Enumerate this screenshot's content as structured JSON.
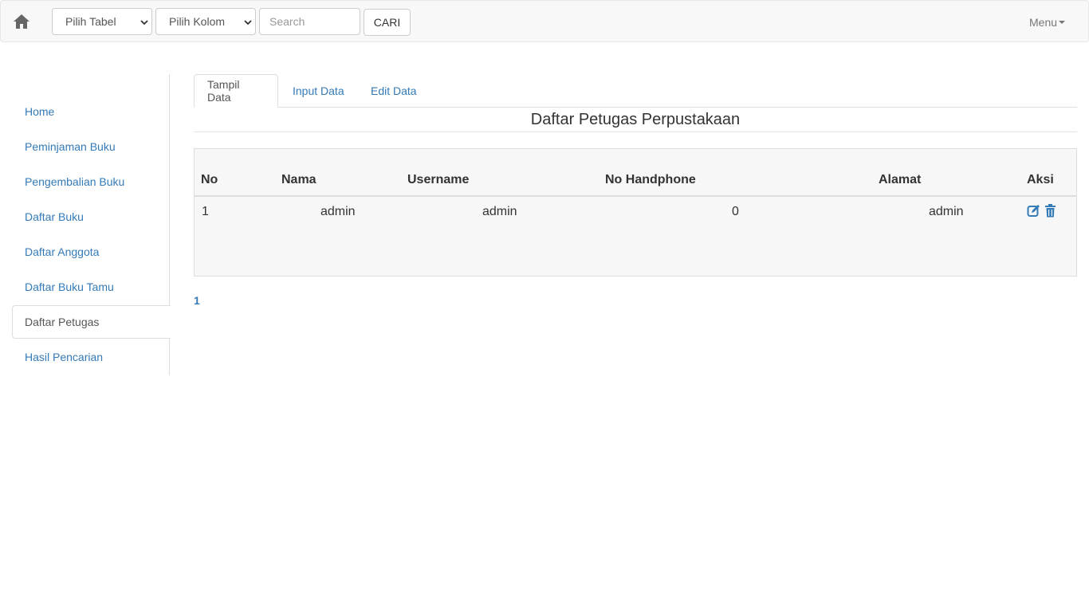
{
  "navbar": {
    "home_icon": "home-icon",
    "table_select": {
      "selected": "Pilih Tabel"
    },
    "column_select": {
      "selected": "Pilih Kolom"
    },
    "search": {
      "placeholder": "Search",
      "value": ""
    },
    "search_button": "CARI",
    "menu_label": "Menu"
  },
  "sidebar": {
    "items": [
      {
        "label": "Home"
      },
      {
        "label": "Peminjaman Buku"
      },
      {
        "label": "Pengembalian Buku"
      },
      {
        "label": "Daftar Buku"
      },
      {
        "label": "Daftar Anggota"
      },
      {
        "label": "Daftar Buku Tamu"
      },
      {
        "label": "Daftar Petugas",
        "active": true
      },
      {
        "label": "Hasil Pencarian"
      }
    ]
  },
  "tabs": [
    {
      "label": "Tampil Data",
      "active": true
    },
    {
      "label": "Input Data"
    },
    {
      "label": "Edit Data"
    }
  ],
  "page_title": "Daftar Petugas Perpustakaan",
  "table": {
    "columns": [
      "No",
      "Nama",
      "Username",
      "No Handphone",
      "Alamat",
      "Aksi"
    ],
    "rows": [
      {
        "no": "1",
        "nama": "admin",
        "username": "admin",
        "no_handphone": "0",
        "alamat": "admin",
        "actions": [
          "edit-icon",
          "trash-icon"
        ]
      }
    ]
  },
  "pagination": {
    "current": "1"
  },
  "colors": {
    "link": "#337ab7",
    "navbar_bg": "#f8f8f8",
    "table_bg": "#f7f7f7",
    "border": "#dddddd"
  }
}
